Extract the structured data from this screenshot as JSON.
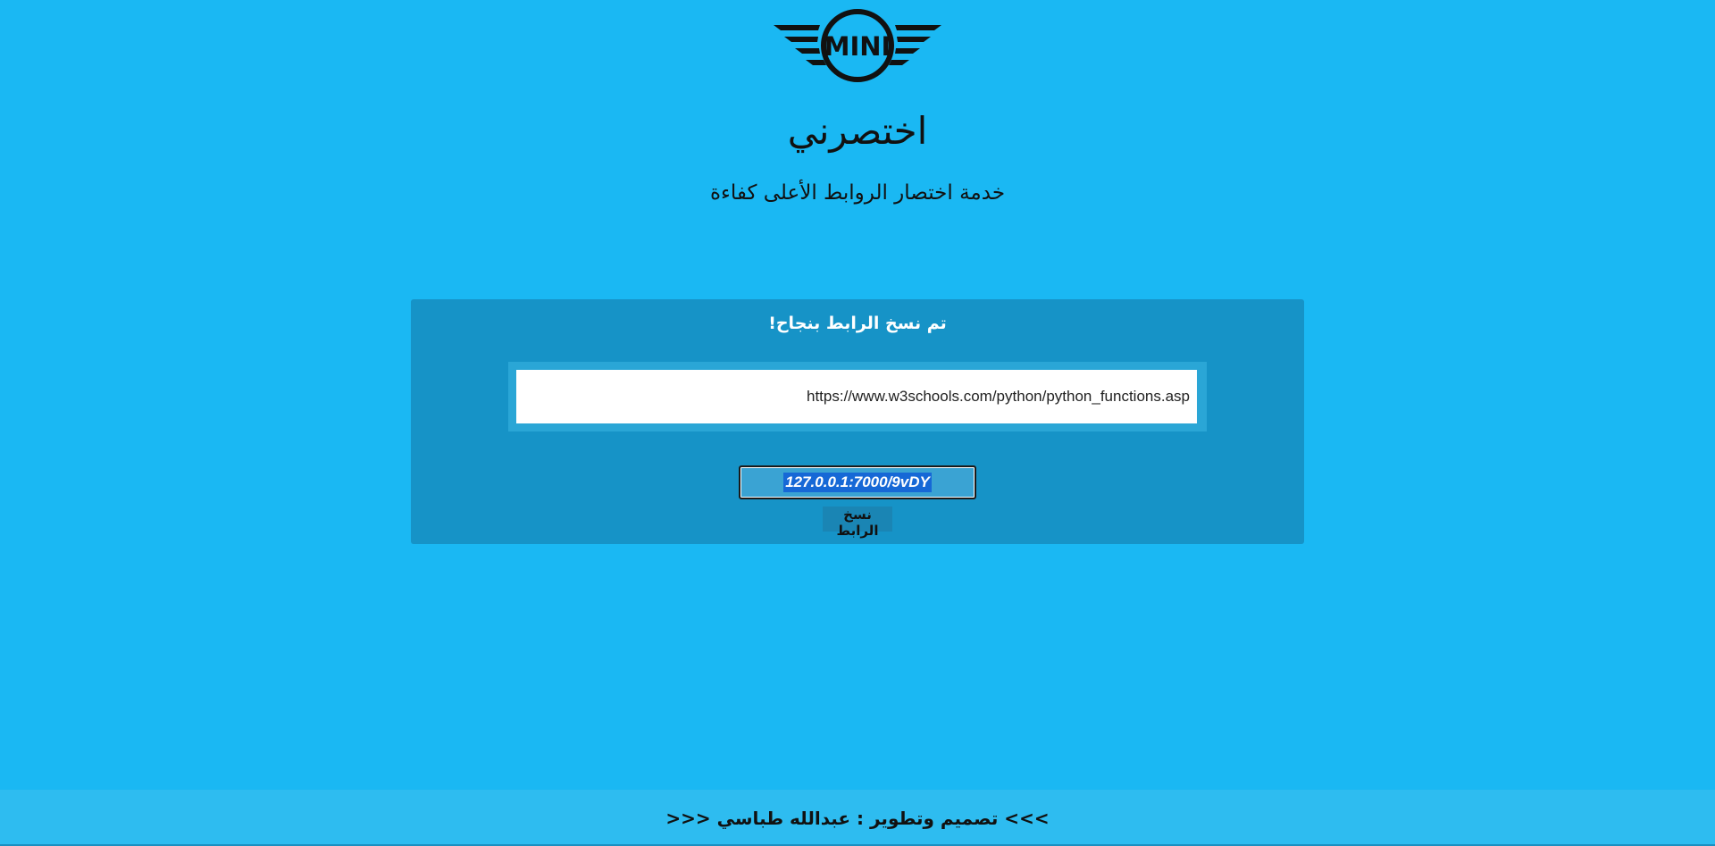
{
  "header": {
    "logo_text": "MINI",
    "title": "اختصرني",
    "subtitle": "خدمة اختصار الروابط الأعلى كفاءة"
  },
  "card": {
    "message": "تم نسخ الرابط بنجاح!",
    "original_url": "https://www.w3schools.com/python/python_functions.asp",
    "short_url": "127.0.0.1:7000/9vDY",
    "copy_label": "نسخ الرابط"
  },
  "footer": {
    "credit": ">>> تصميم وتطوير : عبدالله طباسي <<<"
  },
  "colors": {
    "background": "#1ab8f3",
    "card": "#1693c7",
    "selection": "#1668d6"
  }
}
